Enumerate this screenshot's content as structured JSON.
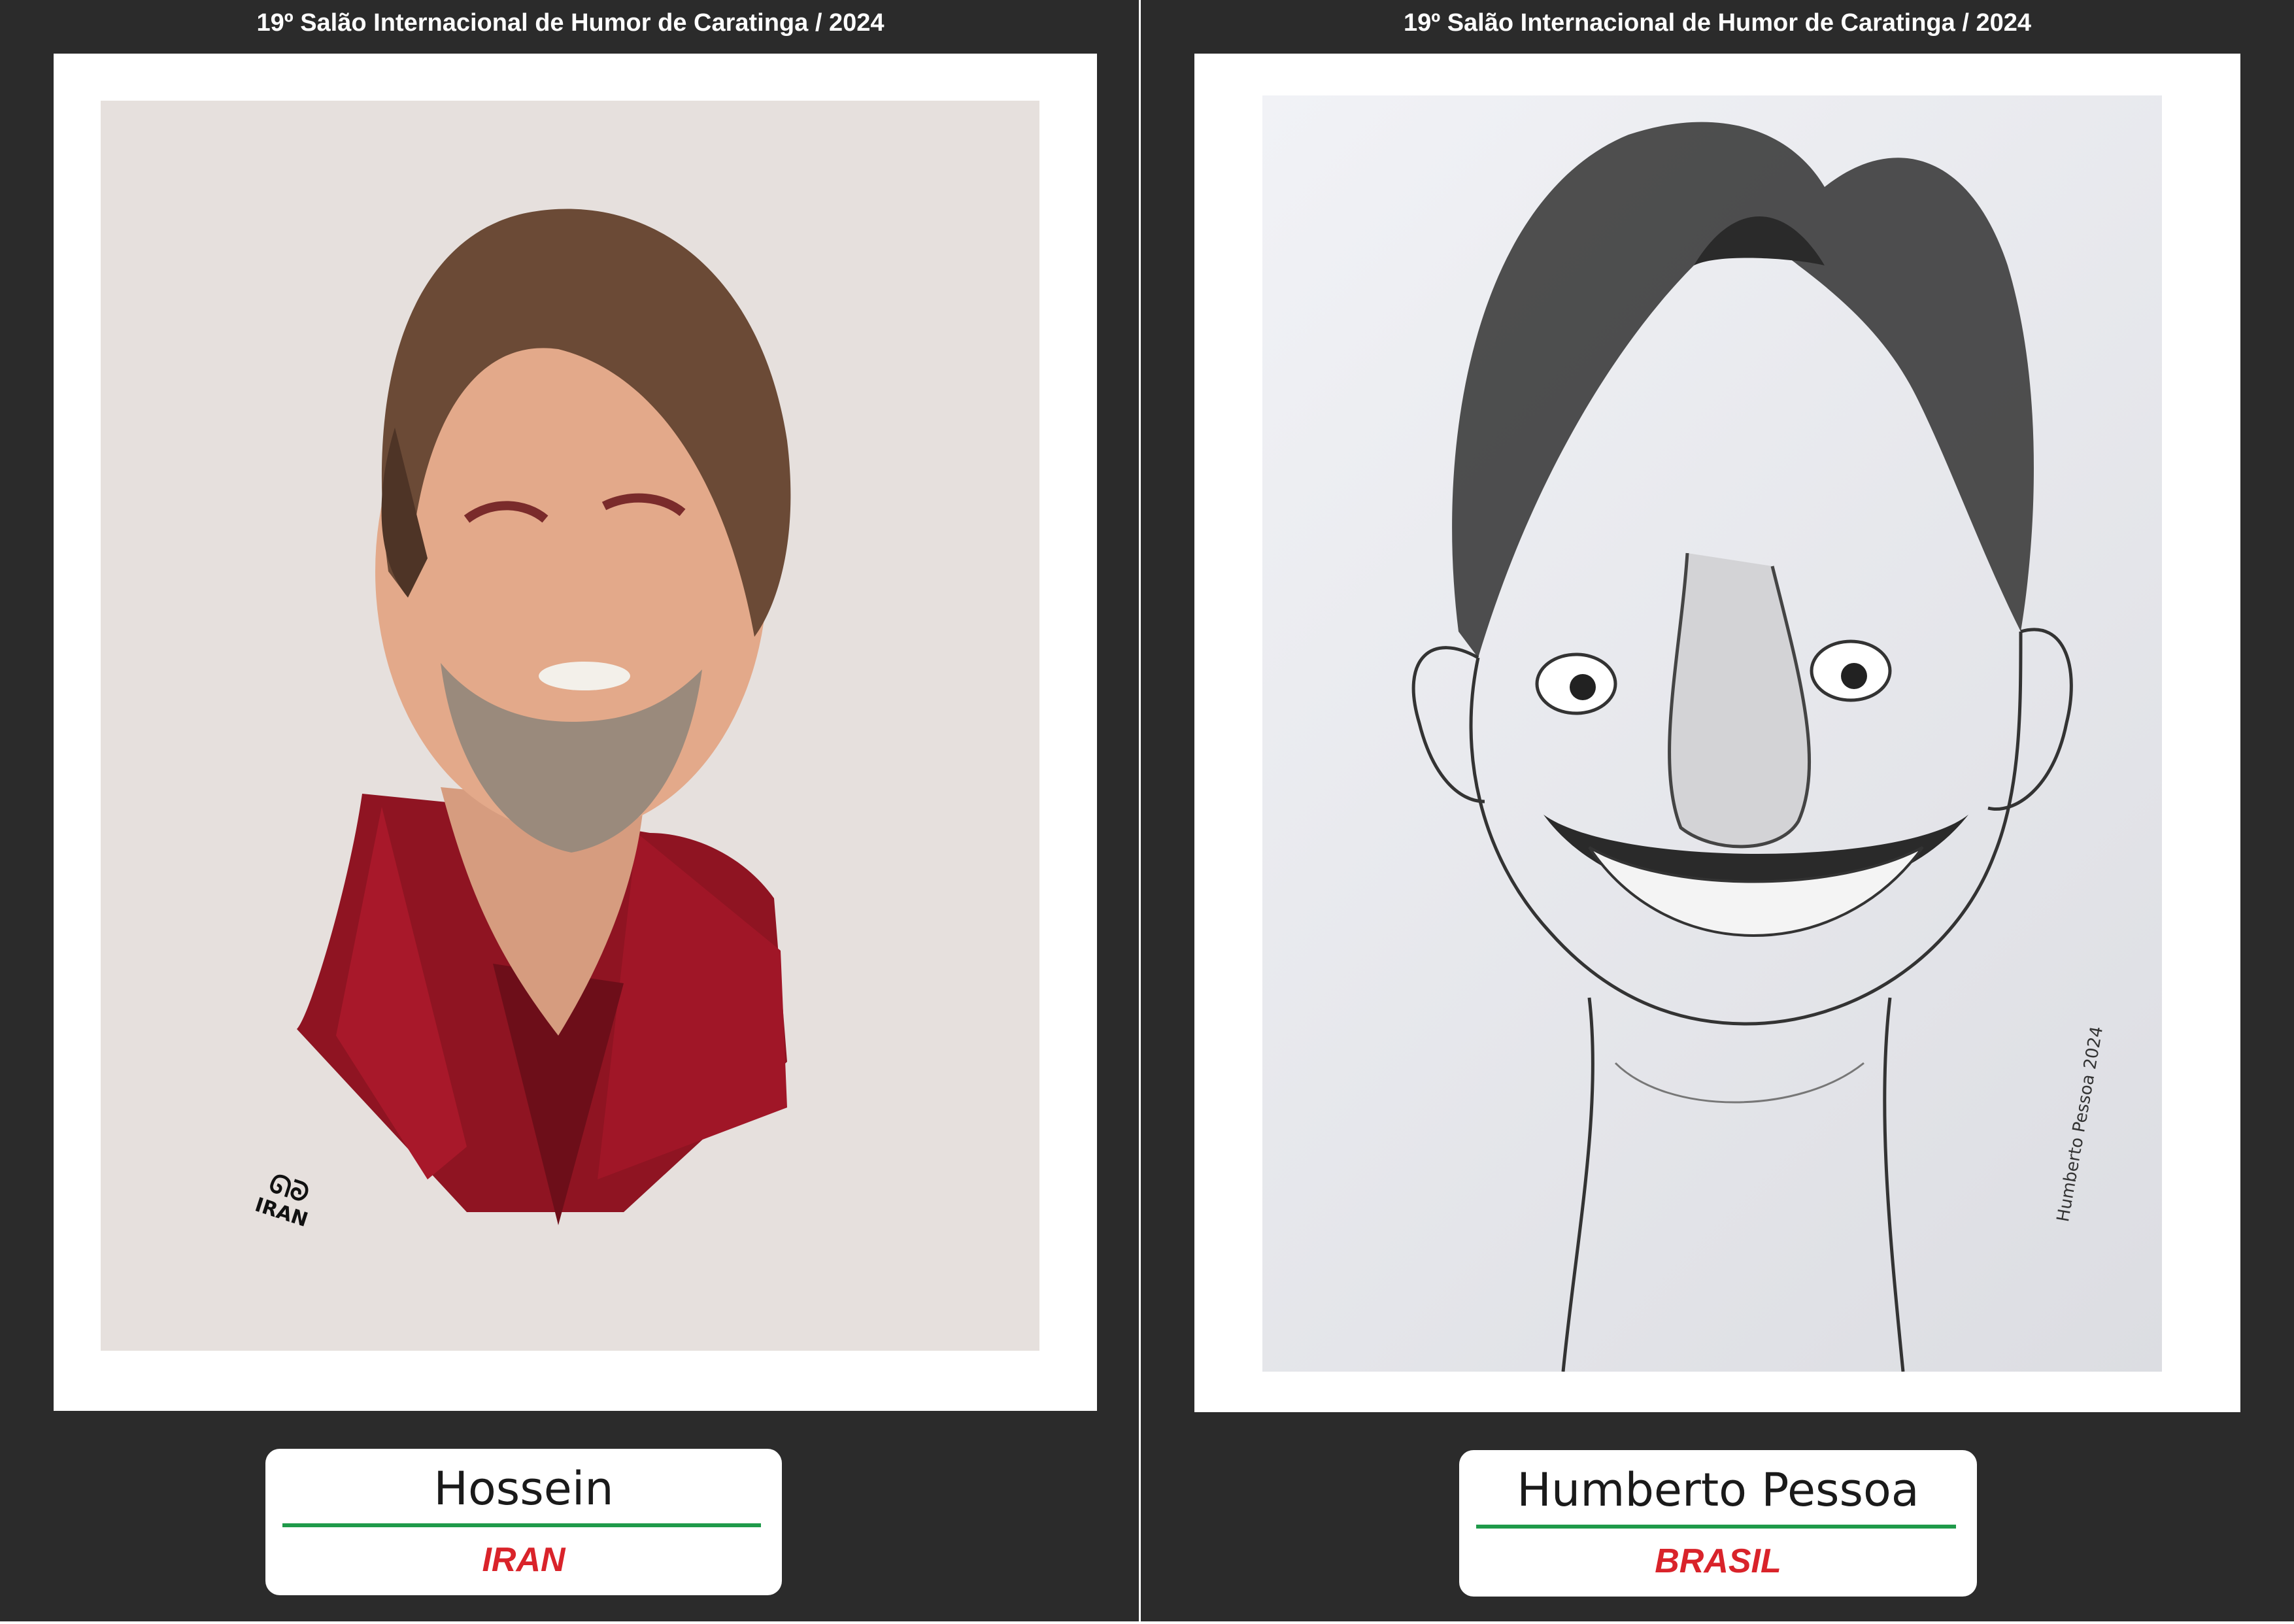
{
  "colors": {
    "background": "#2b2b2b",
    "accent_rule": "#1f9a4a",
    "country_text": "#d9232a",
    "title_text": "#ffffff"
  },
  "panels": [
    {
      "event_title": "19º Salão Internacional de Humor de Caratinga / 2024",
      "artist_name": "Hossein",
      "country": "IRAN",
      "artwork_style": "color-digital-caricature",
      "signature": "IRAN"
    },
    {
      "event_title": "19º Salão Internacional de Humor de Caratinga / 2024",
      "artist_name": "Humberto Pessoa",
      "country": "BRASIL",
      "artwork_style": "pencil-caricature",
      "signature": "Humberto Pessoa 2024"
    }
  ]
}
